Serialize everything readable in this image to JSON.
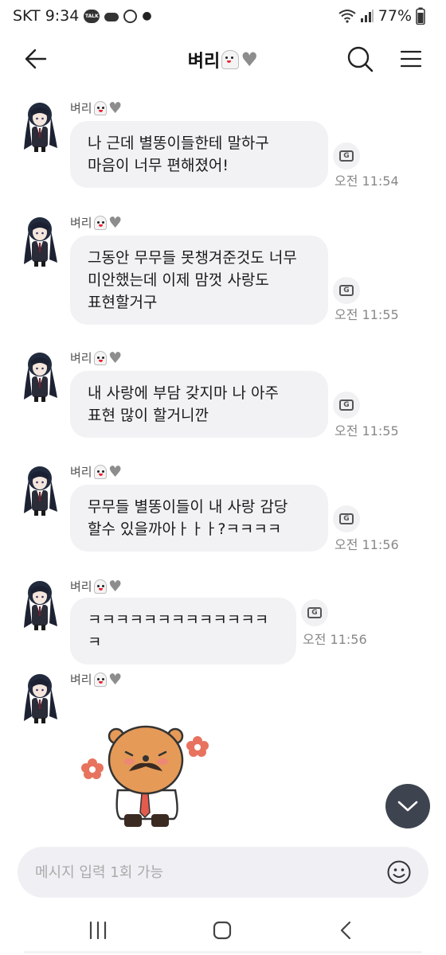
{
  "status_bar": {
    "carrier_time": "SKT 9:34",
    "talk_label": "TALK",
    "battery": "77%"
  },
  "header": {
    "title": "벼리",
    "icons": [
      "back-arrow-icon",
      "ghost-emoji",
      "grey-heart-emoji",
      "search-icon",
      "menu-icon"
    ]
  },
  "chat": {
    "sender_name": "벼리",
    "messages": [
      {
        "text": "나 근데 별똥이들한테 말하구\n마음이 너무 편해졌어!",
        "time": "오전 11:54"
      },
      {
        "text": "그동안 무무들 못챙겨준것도 너무\n미안했는데 이제 맘껏 사랑도\n표현할거구",
        "time": "오전 11:55"
      },
      {
        "text": "내 사랑에 부담 갖지마 나 아주\n표현 많이 할거니깐",
        "time": "오전 11:55"
      },
      {
        "text": "무무들 별똥이들이 내 사랑 감당\n할수 있을까아ㅏㅏㅏ?ㅋㅋㅋㅋ",
        "time": "오전 11:56"
      },
      {
        "text": "ㅋㅋㅋㅋㅋㅋㅋㅋㅋㅋㅋㅋㅋㅋ",
        "time": "오전 11:56"
      }
    ],
    "sticker": "bear-with-mustache-sticker"
  },
  "input": {
    "placeholder": "메시지 입력 1회 가능"
  },
  "colors": {
    "bubble": "#f2f2f5",
    "fab": "#3d4450",
    "input_bg": "#f0f0f4"
  }
}
